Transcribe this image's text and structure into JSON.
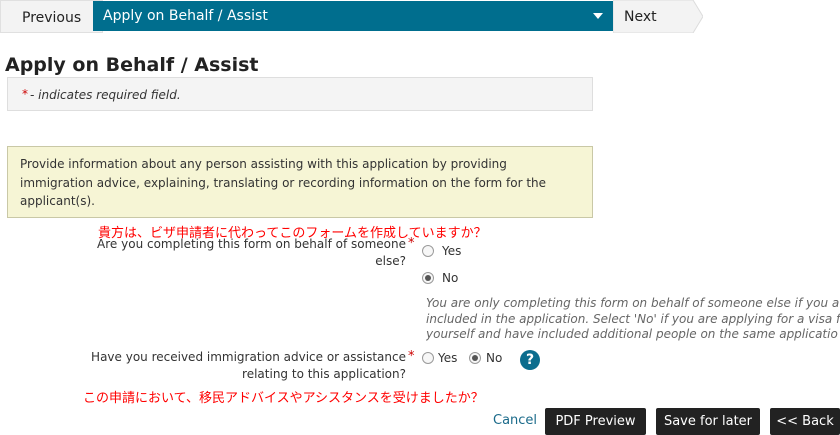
{
  "nav": {
    "previous_label": "Previous",
    "current_page": "Apply on Behalf / Assist",
    "next_label": "Next"
  },
  "page": {
    "title": "Apply on Behalf / Assist",
    "required_star": "*",
    "required_note": "- indicates required field.",
    "info_text": "Provide information about any person assisting with this application by providing immigration advice, explaining, translating or recording information on the form for the applicant(s)."
  },
  "question1": {
    "jp_note": "貴方は、ビザ申請者に代わってこのフォームを作成していますか？",
    "label_line1": "Are you completing this form on behalf of someone",
    "label_line2": "else?",
    "star": "*",
    "options": [
      "Yes",
      "No"
    ],
    "selected": "No",
    "help_lines": [
      "You are only completing this form on behalf of someone else if you a",
      "included in the application. Select 'No' if you are applying for a visa f",
      "yourself and have included additional people on the same applicatio"
    ]
  },
  "question2": {
    "label_line1": "Have you received immigration advice or assistance",
    "label_line2": "relating to this application?",
    "star": "*",
    "options": [
      "Yes",
      "No"
    ],
    "selected": "No",
    "help_icon": "?",
    "jp_note": "この申請において、移民アドバイスやアシスタンスを受けましたか？"
  },
  "footer": {
    "cancel_label": "Cancel",
    "pdf_preview_label": "PDF Preview",
    "save_later_label": "Save for later",
    "back_label": "<< Back"
  },
  "colors": {
    "nav_active": "#006e8e",
    "info_box_bg": "#f6f5d5",
    "required_star": "#cc0000",
    "annotation": "#ff0000",
    "button_bg": "#222222",
    "link": "#1a6a8a"
  }
}
